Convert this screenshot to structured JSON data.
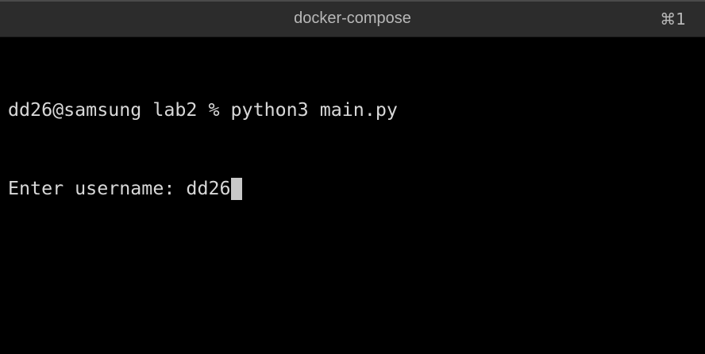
{
  "window": {
    "title": "docker-compose",
    "shortcut": "⌘1"
  },
  "terminal": {
    "lines": [
      "dd26@samsung lab2 % python3 main.py",
      "Enter username: dd26"
    ]
  }
}
